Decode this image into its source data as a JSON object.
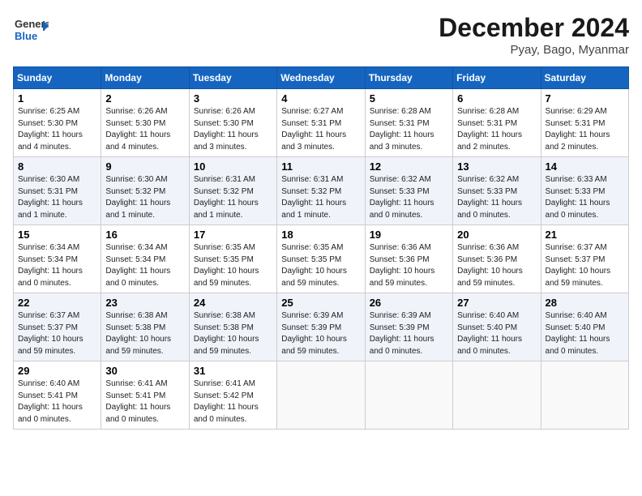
{
  "header": {
    "logo": {
      "line1": "General",
      "line2": "Blue"
    },
    "title": "December 2024",
    "location": "Pyay, Bago, Myanmar"
  },
  "days_of_week": [
    "Sunday",
    "Monday",
    "Tuesday",
    "Wednesday",
    "Thursday",
    "Friday",
    "Saturday"
  ],
  "weeks": [
    [
      {
        "day": "1",
        "info": "Sunrise: 6:25 AM\nSunset: 5:30 PM\nDaylight: 11 hours\nand 4 minutes."
      },
      {
        "day": "2",
        "info": "Sunrise: 6:26 AM\nSunset: 5:30 PM\nDaylight: 11 hours\nand 4 minutes."
      },
      {
        "day": "3",
        "info": "Sunrise: 6:26 AM\nSunset: 5:30 PM\nDaylight: 11 hours\nand 3 minutes."
      },
      {
        "day": "4",
        "info": "Sunrise: 6:27 AM\nSunset: 5:31 PM\nDaylight: 11 hours\nand 3 minutes."
      },
      {
        "day": "5",
        "info": "Sunrise: 6:28 AM\nSunset: 5:31 PM\nDaylight: 11 hours\nand 3 minutes."
      },
      {
        "day": "6",
        "info": "Sunrise: 6:28 AM\nSunset: 5:31 PM\nDaylight: 11 hours\nand 2 minutes."
      },
      {
        "day": "7",
        "info": "Sunrise: 6:29 AM\nSunset: 5:31 PM\nDaylight: 11 hours\nand 2 minutes."
      }
    ],
    [
      {
        "day": "8",
        "info": "Sunrise: 6:30 AM\nSunset: 5:31 PM\nDaylight: 11 hours\nand 1 minute."
      },
      {
        "day": "9",
        "info": "Sunrise: 6:30 AM\nSunset: 5:32 PM\nDaylight: 11 hours\nand 1 minute."
      },
      {
        "day": "10",
        "info": "Sunrise: 6:31 AM\nSunset: 5:32 PM\nDaylight: 11 hours\nand 1 minute."
      },
      {
        "day": "11",
        "info": "Sunrise: 6:31 AM\nSunset: 5:32 PM\nDaylight: 11 hours\nand 1 minute."
      },
      {
        "day": "12",
        "info": "Sunrise: 6:32 AM\nSunset: 5:33 PM\nDaylight: 11 hours\nand 0 minutes."
      },
      {
        "day": "13",
        "info": "Sunrise: 6:32 AM\nSunset: 5:33 PM\nDaylight: 11 hours\nand 0 minutes."
      },
      {
        "day": "14",
        "info": "Sunrise: 6:33 AM\nSunset: 5:33 PM\nDaylight: 11 hours\nand 0 minutes."
      }
    ],
    [
      {
        "day": "15",
        "info": "Sunrise: 6:34 AM\nSunset: 5:34 PM\nDaylight: 11 hours\nand 0 minutes."
      },
      {
        "day": "16",
        "info": "Sunrise: 6:34 AM\nSunset: 5:34 PM\nDaylight: 11 hours\nand 0 minutes."
      },
      {
        "day": "17",
        "info": "Sunrise: 6:35 AM\nSunset: 5:35 PM\nDaylight: 10 hours\nand 59 minutes."
      },
      {
        "day": "18",
        "info": "Sunrise: 6:35 AM\nSunset: 5:35 PM\nDaylight: 10 hours\nand 59 minutes."
      },
      {
        "day": "19",
        "info": "Sunrise: 6:36 AM\nSunset: 5:36 PM\nDaylight: 10 hours\nand 59 minutes."
      },
      {
        "day": "20",
        "info": "Sunrise: 6:36 AM\nSunset: 5:36 PM\nDaylight: 10 hours\nand 59 minutes."
      },
      {
        "day": "21",
        "info": "Sunrise: 6:37 AM\nSunset: 5:37 PM\nDaylight: 10 hours\nand 59 minutes."
      }
    ],
    [
      {
        "day": "22",
        "info": "Sunrise: 6:37 AM\nSunset: 5:37 PM\nDaylight: 10 hours\nand 59 minutes."
      },
      {
        "day": "23",
        "info": "Sunrise: 6:38 AM\nSunset: 5:38 PM\nDaylight: 10 hours\nand 59 minutes."
      },
      {
        "day": "24",
        "info": "Sunrise: 6:38 AM\nSunset: 5:38 PM\nDaylight: 10 hours\nand 59 minutes."
      },
      {
        "day": "25",
        "info": "Sunrise: 6:39 AM\nSunset: 5:39 PM\nDaylight: 10 hours\nand 59 minutes."
      },
      {
        "day": "26",
        "info": "Sunrise: 6:39 AM\nSunset: 5:39 PM\nDaylight: 11 hours\nand 0 minutes."
      },
      {
        "day": "27",
        "info": "Sunrise: 6:40 AM\nSunset: 5:40 PM\nDaylight: 11 hours\nand 0 minutes."
      },
      {
        "day": "28",
        "info": "Sunrise: 6:40 AM\nSunset: 5:40 PM\nDaylight: 11 hours\nand 0 minutes."
      }
    ],
    [
      {
        "day": "29",
        "info": "Sunrise: 6:40 AM\nSunset: 5:41 PM\nDaylight: 11 hours\nand 0 minutes."
      },
      {
        "day": "30",
        "info": "Sunrise: 6:41 AM\nSunset: 5:41 PM\nDaylight: 11 hours\nand 0 minutes."
      },
      {
        "day": "31",
        "info": "Sunrise: 6:41 AM\nSunset: 5:42 PM\nDaylight: 11 hours\nand 0 minutes."
      },
      {
        "day": "",
        "info": ""
      },
      {
        "day": "",
        "info": ""
      },
      {
        "day": "",
        "info": ""
      },
      {
        "day": "",
        "info": ""
      }
    ]
  ]
}
